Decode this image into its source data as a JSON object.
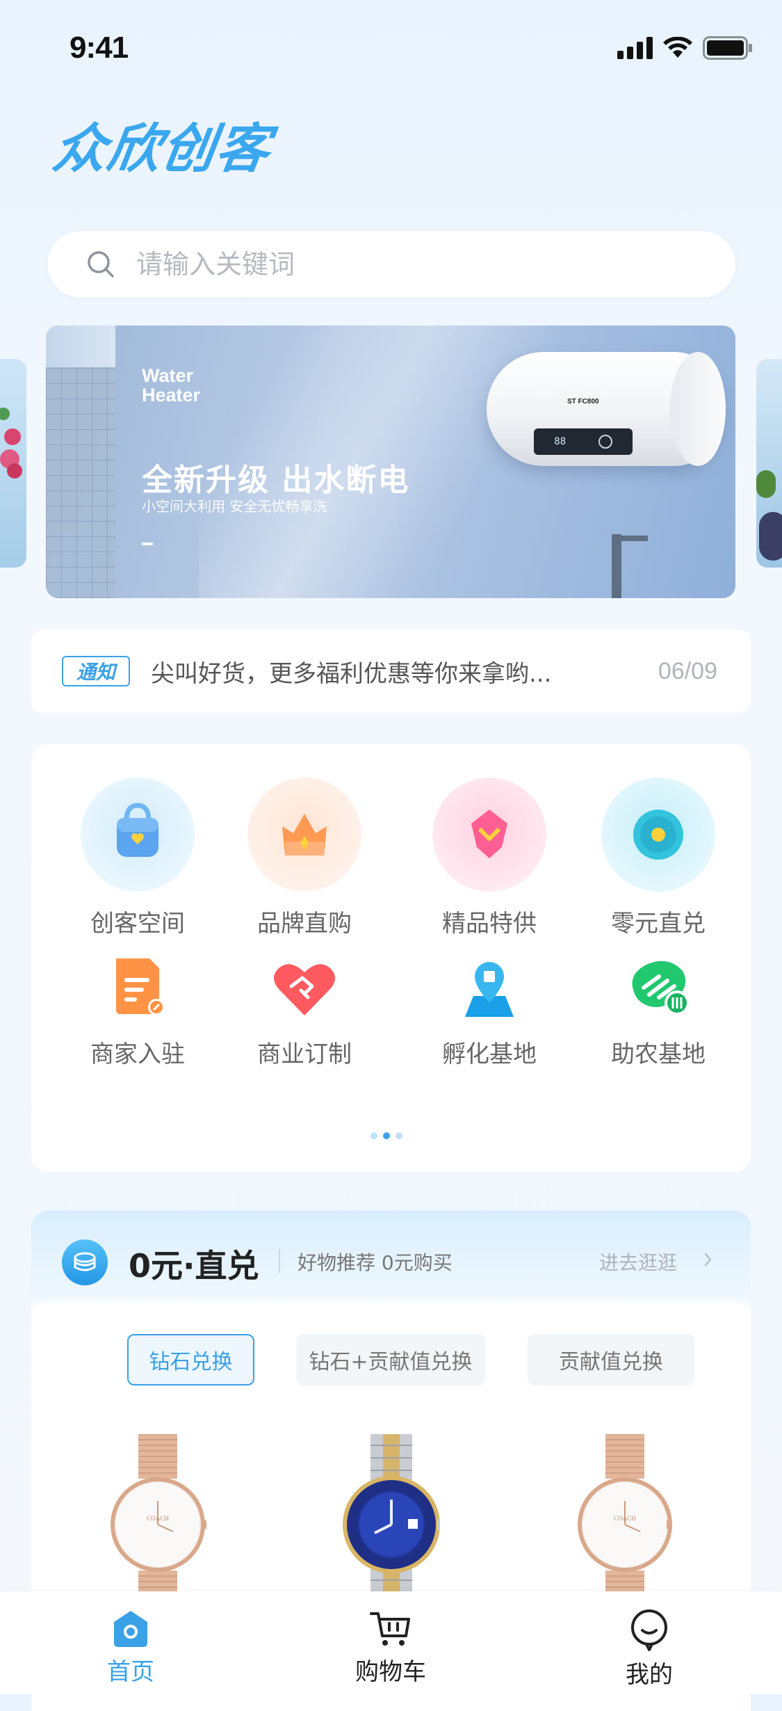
{
  "status_bar": {
    "time": "9:41"
  },
  "app": {
    "logo_text": "众欣创客"
  },
  "search": {
    "placeholder": "请输入关键词"
  },
  "banner": {
    "subtitle_en": "Water\nHeater",
    "title": "全新升级 出水断电",
    "description": "小空间大利用 安全无忧畅享洗",
    "product_brand": "ST FC800"
  },
  "notice": {
    "badge": "通知",
    "text": "尖叫好货，更多福利优惠等你来拿哟...",
    "date": "06/09"
  },
  "grid": {
    "items": [
      {
        "label": "创客空间",
        "icon": "bag-icon"
      },
      {
        "label": "品牌直购",
        "icon": "crown-icon"
      },
      {
        "label": "精品特供",
        "icon": "gem-icon"
      },
      {
        "label": "零元直兑",
        "icon": "coin-icon"
      },
      {
        "label": "商家入驻",
        "icon": "document-icon"
      },
      {
        "label": "商业订制",
        "icon": "handshake-heart-icon"
      },
      {
        "label": "孵化基地",
        "icon": "map-pin-icon"
      },
      {
        "label": "助农基地",
        "icon": "farm-icon"
      }
    ],
    "pagination": {
      "pages": 3,
      "current": 2
    }
  },
  "zero_exchange": {
    "title": "0元·直兑",
    "subtitle": "好物推荐 0元购买",
    "more": "进去逛逛",
    "tabs": [
      {
        "label": "钻石兑换",
        "active": true
      },
      {
        "label": "钻石+贡献值兑换",
        "active": false
      },
      {
        "label": "贡献值兑换",
        "active": false
      }
    ],
    "products": [
      {
        "name": "rose-gold-mesh-watch"
      },
      {
        "name": "blue-dial-steel-watch"
      },
      {
        "name": "rose-gold-mesh-watch"
      }
    ]
  },
  "tabbar": {
    "items": [
      {
        "label": "首页",
        "active": true
      },
      {
        "label": "购物车",
        "active": false
      },
      {
        "label": "我的",
        "active": false
      }
    ]
  },
  "colors": {
    "accent": "#3aa1e6",
    "text_primary": "#222222",
    "text_secondary": "#666666",
    "placeholder": "#b6b9bf"
  }
}
